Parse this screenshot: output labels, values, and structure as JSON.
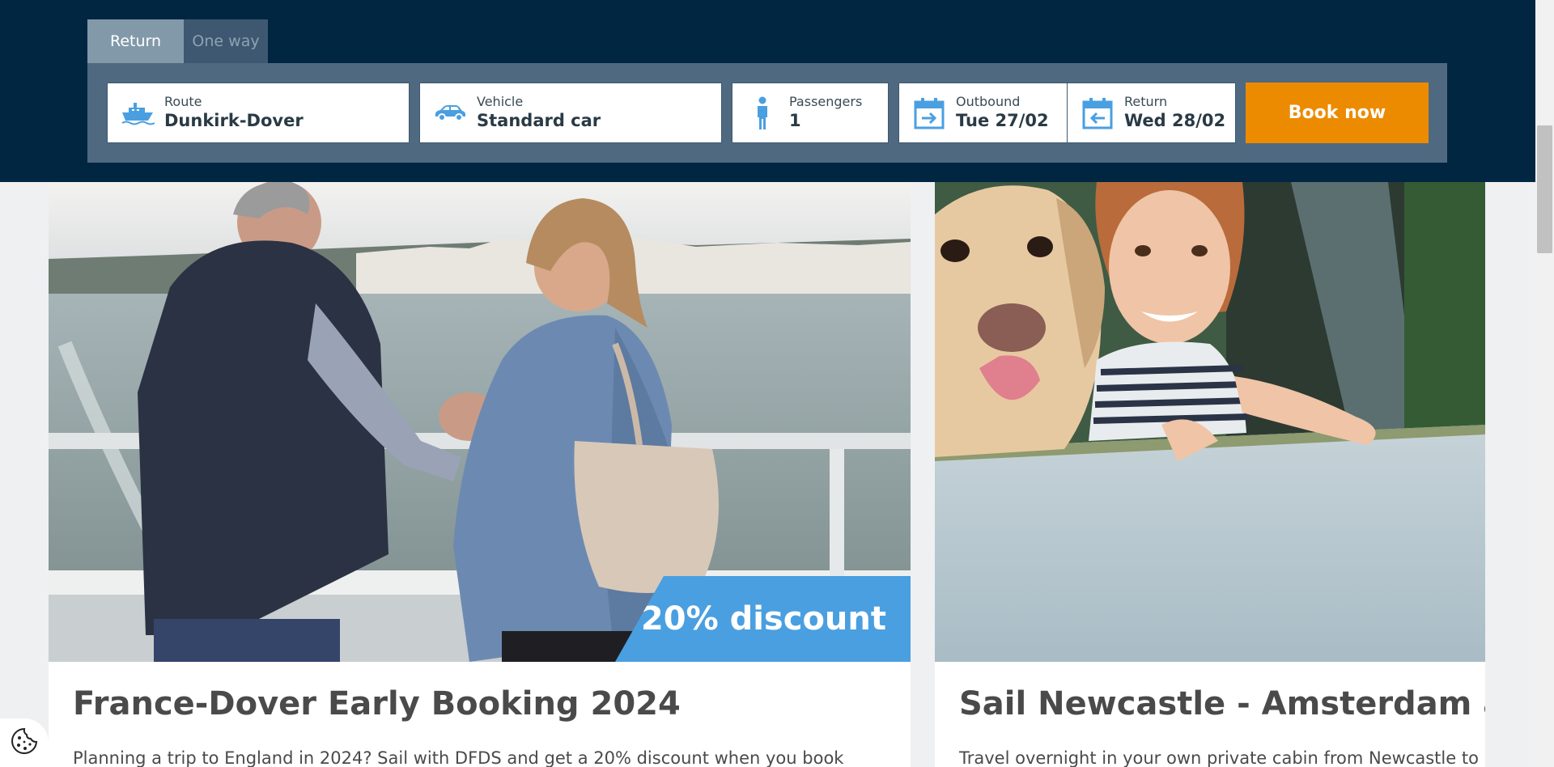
{
  "booking": {
    "tabs": [
      {
        "label": "Return",
        "active": true
      },
      {
        "label": "One way",
        "active": false
      }
    ],
    "fields": {
      "route": {
        "label": "Route",
        "value": "Dunkirk-Dover",
        "icon": "ship-icon"
      },
      "vehicle": {
        "label": "Vehicle",
        "value": "Standard car",
        "icon": "car-icon"
      },
      "passengers": {
        "label": "Passengers",
        "value": "1",
        "icon": "person-icon"
      },
      "outbound": {
        "label": "Outbound",
        "value": "Tue 27/02",
        "icon": "calendar-outbound-icon"
      },
      "return": {
        "label": "Return",
        "value": "Wed 28/02",
        "icon": "calendar-return-icon"
      }
    },
    "book_now_label": "Book now"
  },
  "cards": [
    {
      "title": "France-Dover Early Booking 2024",
      "text": "Planning a trip to England in 2024? Sail with DFDS and get a 20% discount when you book",
      "badge": "20% discount"
    },
    {
      "title": "Sail Newcastle - Amsterdam and v",
      "text": "Travel overnight in your own private cabin from Newcastle to"
    }
  ],
  "colors": {
    "header_bg": "#012642",
    "panel_bg": "#4f6a80",
    "accent_orange": "#ed8b00",
    "badge_blue": "#4a9fe0",
    "icon_blue": "#4a9fe0"
  }
}
